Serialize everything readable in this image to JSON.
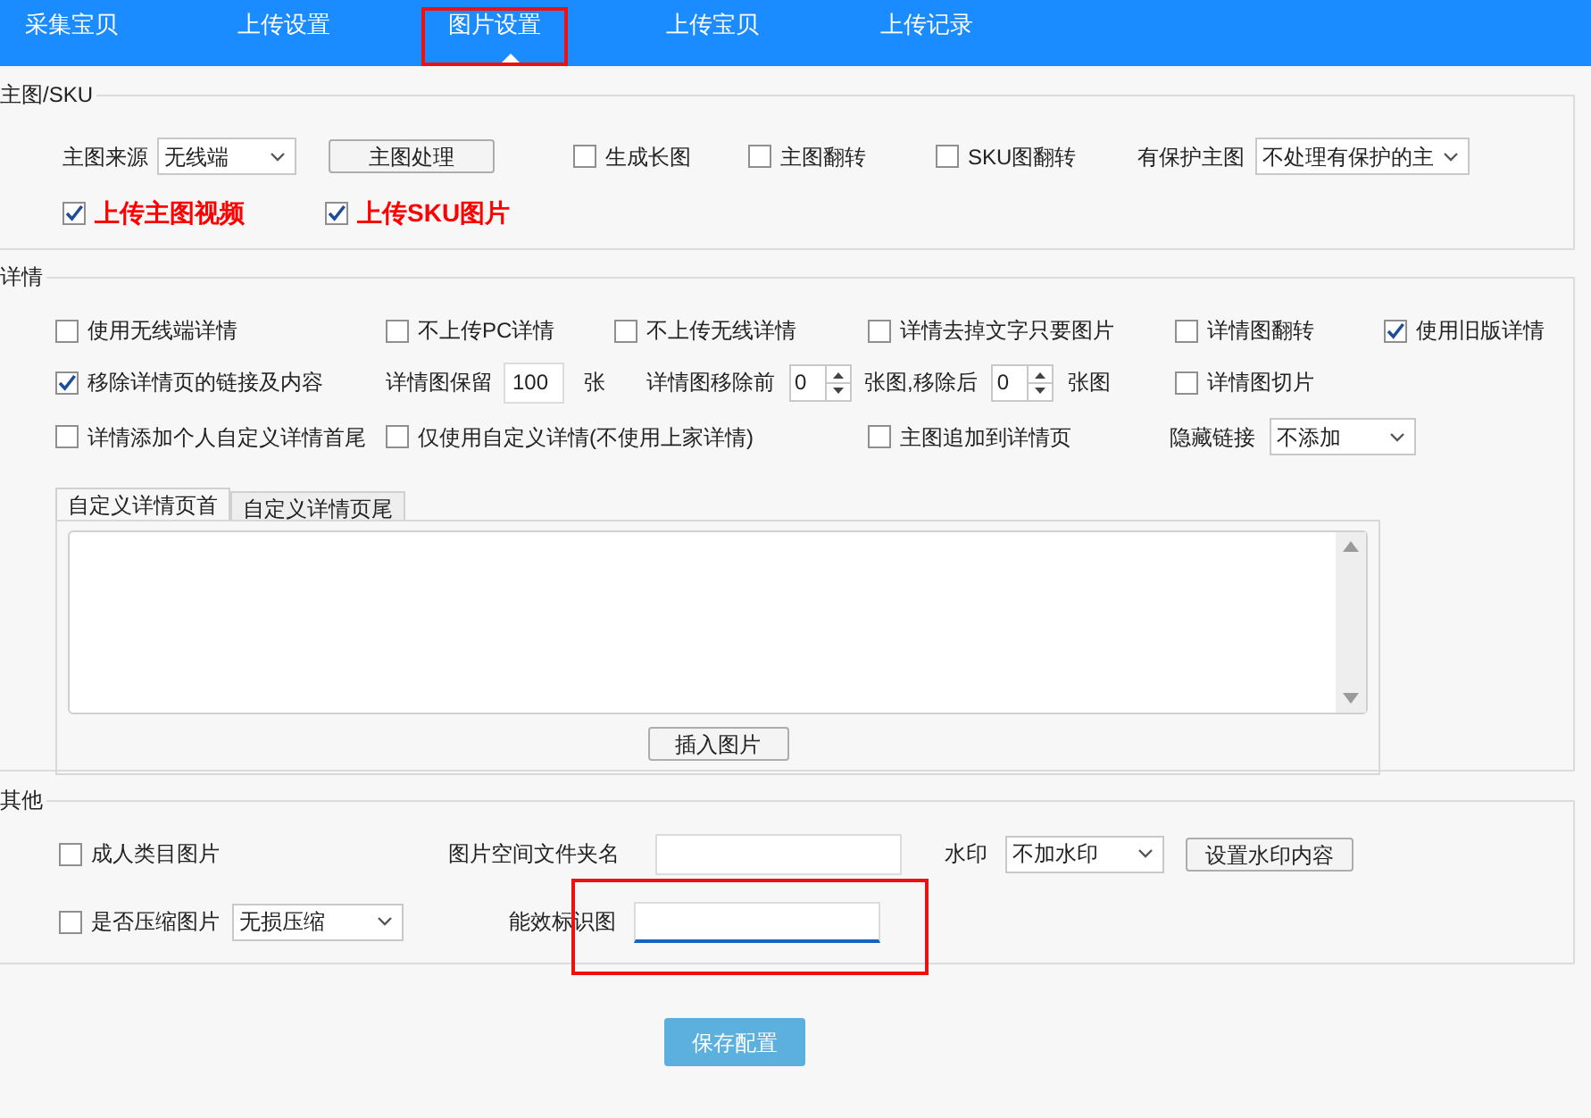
{
  "tabs": [
    {
      "label": "采集宝贝",
      "selected": false
    },
    {
      "label": "上传设置",
      "selected": false
    },
    {
      "label": "图片设置",
      "selected": true
    },
    {
      "label": "上传宝贝",
      "selected": false
    },
    {
      "label": "上传记录",
      "selected": false
    }
  ],
  "groups": [
    {
      "title": "主图/SKU",
      "items": [
        {
          "kind": "select",
          "label": "主图来源",
          "value": "无线端"
        },
        {
          "kind": "button",
          "label": "主图处理"
        },
        {
          "kind": "checkbox",
          "label": "生成长图",
          "checked": false
        },
        {
          "kind": "checkbox",
          "label": "主图翻转",
          "checked": false
        },
        {
          "kind": "checkbox",
          "label": "SKU图翻转",
          "checked": false
        },
        {
          "kind": "select",
          "label": "有保护主图",
          "value": "不处理有保护的主"
        },
        {
          "kind": "emphasis_checkbox",
          "label": "上传主图视频",
          "checked": true
        },
        {
          "kind": "emphasis_checkbox",
          "label": "上传SKU图片",
          "checked": true
        }
      ]
    },
    {
      "title": "详情",
      "items": [
        {
          "kind": "checkbox",
          "label": "使用无线端详情",
          "checked": false
        },
        {
          "kind": "checkbox",
          "label": "不上传PC详情",
          "checked": false
        },
        {
          "kind": "checkbox",
          "label": "不上传无线详情",
          "checked": false
        },
        {
          "kind": "checkbox",
          "label": "详情去掉文字只要图片",
          "checked": false
        },
        {
          "kind": "checkbox",
          "label": "详情图翻转",
          "checked": false
        },
        {
          "kind": "checkbox",
          "label": "使用旧版详情",
          "checked": true
        },
        {
          "kind": "checkbox",
          "label": "移除详情页的链接及内容",
          "checked": true
        },
        {
          "kind": "field",
          "label": "详情图保留",
          "value": "100",
          "suffix": "张",
          "focused": false
        },
        {
          "kind": "spinner",
          "label": "详情图移除前",
          "value": "0"
        },
        {
          "kind": "spinner",
          "label": "张图,移除后",
          "value": "0"
        },
        {
          "kind": "text",
          "label": "张图"
        },
        {
          "kind": "checkbox",
          "label": "详情图切片",
          "checked": false
        },
        {
          "kind": "checkbox",
          "label": "详情添加个人自定义详情首尾",
          "checked": false
        },
        {
          "kind": "checkbox",
          "label": "仅使用自定义详情(不使用上家详情)",
          "checked": false
        },
        {
          "kind": "checkbox",
          "label": "主图追加到详情页",
          "checked": false
        },
        {
          "kind": "select",
          "label": "隐藏链接",
          "value": "不添加"
        }
      ],
      "editor": {
        "tabs": [
          {
            "label": "自定义详情页首",
            "selected": true
          },
          {
            "label": "自定义详情页尾",
            "selected": false
          }
        ],
        "button": "插入图片"
      }
    },
    {
      "title": "其他",
      "items": [
        {
          "kind": "checkbox",
          "label": "成人类目图片",
          "checked": false
        },
        {
          "kind": "field",
          "label": "图片空间文件夹名",
          "focused": false
        },
        {
          "kind": "select",
          "label": "水印",
          "value": "不加水印"
        },
        {
          "kind": "button",
          "label": "设置水印内容"
        },
        {
          "kind": "checkbox",
          "label": "是否压缩图片",
          "checked": false
        },
        {
          "kind": "select",
          "value": "无损压缩"
        },
        {
          "kind": "field",
          "label": "能效标识图",
          "focused": true
        }
      ]
    }
  ],
  "save_button": "保存配置"
}
